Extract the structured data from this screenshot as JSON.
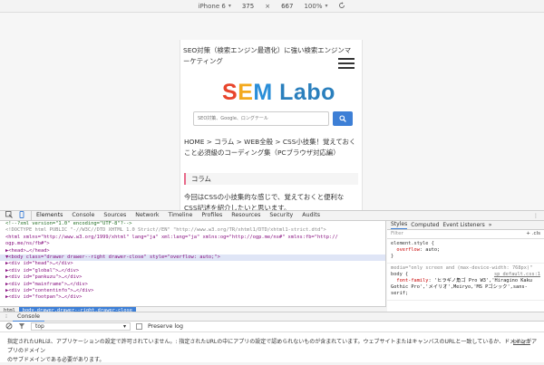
{
  "device_toolbar": {
    "device": "iPhone 6",
    "width": "375",
    "times": "×",
    "height": "667",
    "zoom": "100%"
  },
  "page": {
    "header_line1": "SEO対策（検索エンジン最適化）に強い検索エンジンマ",
    "header_line2": "ーケティング",
    "logo_s": "S",
    "logo_e": "E",
    "logo_m": "M",
    "logo_rest": " Labo",
    "search_placeholder": "SEO対策、Google、ロングテール",
    "breadcrumb_line1": "HOME > コラム > WEB全般 > CSS小技集！覚えておく",
    "breadcrumb_line2": "こと必須級のコーディング集（PCブラウザ対応編）",
    "section_title": "コラム",
    "intro_line1": "今回はCSSの小技集的な感じで、覚えておくと便利な",
    "intro_line2": "CSS記述を紹介したいと思います。"
  },
  "devtools": {
    "tabs": [
      "Elements",
      "Console",
      "Sources",
      "Network",
      "Timeline",
      "Profiles",
      "Resources",
      "Security",
      "Audits"
    ],
    "more": "⋮",
    "dom_lines": [
      {
        "text": "<!--?xml version=\"1.0\" encoding=\"UTF-8\"?-->",
        "cls": "c-com"
      },
      {
        "text": "<!DOCTYPE html PUBLIC \"-//W3C//DTD XHTML 1.0 Strict//EN\" \"http://www.w3.org/TR/xhtml1/DTD/xhtml1-strict.dtd\">",
        "cls": "c-dim"
      },
      {
        "text": "<html xmlns=\"http://www.w3.org/1999/xhtml\" lang=\"ja\" xml:lang=\"ja\" xmlns:og=\"http://ogp.me/ns#\" xmlns:fb=\"http://",
        "cls": "c-tag"
      },
      {
        "text": "ogp.me/ns/fb#\">",
        "cls": "c-tag"
      },
      {
        "text": "  ▶<head>…</head>",
        "cls": "c-tag"
      },
      {
        "text": "  ▼<body class=\"drawer drawer--right drawer-close\" style=\"overflow: auto;\">",
        "cls": "c-tag",
        "sel": true
      },
      {
        "text": "    ▶<div id=\"head\">…</div>",
        "cls": "c-tag"
      },
      {
        "text": "    ▶<div id=\"global\">…</div>",
        "cls": "c-tag"
      },
      {
        "text": "    ▶<div id=\"pankuzu\">…</div>",
        "cls": "c-tag"
      },
      {
        "text": "    ▶<div id=\"mainframe\">…</div>",
        "cls": "c-tag"
      },
      {
        "text": "    ▶<div id=\"contentinfo\">…</div>",
        "cls": "c-tag"
      },
      {
        "text": "    ▶<div id=\"footpan\">…</div>",
        "cls": "c-tag"
      }
    ],
    "crumb_html": "html",
    "crumb_body": "body.drawer.drawer--right.drawer-close",
    "styles_tabs": [
      "Styles",
      "Computed",
      "Event Listeners",
      "»"
    ],
    "filter_placeholder": "Filter",
    "filter_right": "+ .cls",
    "element_style": "element.style {",
    "element_prop": "overflow",
    "element_val": "auto;",
    "close_brace": "}",
    "media": "media=\"only screen and (max-device-width: 768px)\"",
    "body_sel": "body {",
    "body_src": "sp_default.css:1",
    "font_prop": "font-family",
    "font_val": "'ヒラギノ角ゴ Pro W3','Hiragino Kaku Gothic Pro','メイリオ',Meiryo,'MS Pゴシック',sans-serif;"
  },
  "console": {
    "tab_label": "Console",
    "context": "top",
    "preserve_label": "Preserve log",
    "message_line1": "指定されたURLは、アプリケーションの設定で許可されていません。: 指定されたURLの中にアプリの設定で認められないものが含まれています。ウェブサイトまたはキャンバスのURLと一致しているか、ドメインがアプリのドメイン",
    "message_line2": "のサブドメインである必要があります。",
    "message_link": "ping:1"
  }
}
